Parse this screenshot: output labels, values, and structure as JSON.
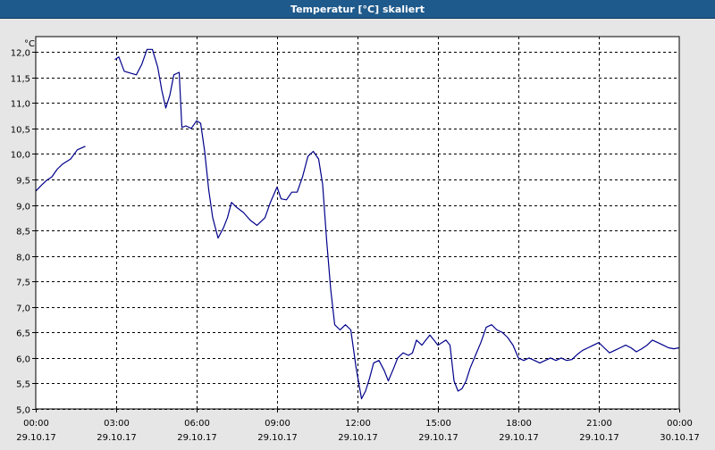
{
  "window": {
    "title": "Temperatur [°C] skaliert"
  },
  "chart_data": {
    "type": "line",
    "title": "Temperatur [°C] skaliert",
    "ylabel": "°C",
    "xlabel": "",
    "ylim": [
      5.0,
      12.3
    ],
    "xlim": [
      0,
      24
    ],
    "grid": true,
    "x_unit": "hours since 29.10.17 00:00",
    "y_ticks": [
      "5,0",
      "5,5",
      "6,0",
      "6,5",
      "7,0",
      "7,5",
      "8,0",
      "8,5",
      "9,0",
      "9,5",
      "10,0",
      "10,5",
      "11,0",
      "11,5",
      "12,0"
    ],
    "y_tick_values": [
      5.0,
      5.5,
      6.0,
      6.5,
      7.0,
      7.5,
      8.0,
      8.5,
      9.0,
      9.5,
      10.0,
      10.5,
      11.0,
      11.5,
      12.0
    ],
    "x_ticks": [
      {
        "time": "00:00",
        "date": "29.10.17",
        "hour": 0
      },
      {
        "time": "03:00",
        "date": "29.10.17",
        "hour": 3
      },
      {
        "time": "06:00",
        "date": "29.10.17",
        "hour": 6
      },
      {
        "time": "09:00",
        "date": "29.10.17",
        "hour": 9
      },
      {
        "time": "12:00",
        "date": "29.10.17",
        "hour": 12
      },
      {
        "time": "15:00",
        "date": "29.10.17",
        "hour": 15
      },
      {
        "time": "18:00",
        "date": "29.10.17",
        "hour": 18
      },
      {
        "time": "21:00",
        "date": "29.10.17",
        "hour": 21
      },
      {
        "time": "00:00",
        "date": "30.10.17",
        "hour": 24
      }
    ],
    "series": [
      {
        "color": "#00008b",
        "segments": [
          [
            [
              0.0,
              9.27
            ],
            [
              0.2,
              9.38
            ],
            [
              0.4,
              9.48
            ],
            [
              0.6,
              9.55
            ],
            [
              0.8,
              9.7
            ],
            [
              1.0,
              9.8
            ],
            [
              1.3,
              9.9
            ],
            [
              1.55,
              10.08
            ],
            [
              1.85,
              10.15
            ]
          ],
          [
            [
              2.95,
              11.85
            ],
            [
              3.1,
              11.9
            ],
            [
              3.3,
              11.62
            ],
            [
              3.55,
              11.58
            ],
            [
              3.75,
              11.55
            ],
            [
              3.95,
              11.75
            ],
            [
              4.15,
              12.05
            ],
            [
              4.35,
              12.05
            ],
            [
              4.55,
              11.7
            ],
            [
              4.7,
              11.25
            ],
            [
              4.85,
              10.9
            ],
            [
              5.0,
              11.15
            ],
            [
              5.15,
              11.55
            ],
            [
              5.35,
              11.6
            ],
            [
              5.45,
              10.52
            ],
            [
              5.6,
              10.55
            ],
            [
              5.8,
              10.5
            ],
            [
              6.0,
              10.65
            ],
            [
              6.15,
              10.6
            ],
            [
              6.3,
              10.05
            ],
            [
              6.45,
              9.3
            ],
            [
              6.6,
              8.75
            ],
            [
              6.8,
              8.35
            ],
            [
              7.0,
              8.55
            ],
            [
              7.15,
              8.75
            ],
            [
              7.3,
              9.05
            ],
            [
              7.5,
              8.95
            ],
            [
              7.75,
              8.85
            ],
            [
              8.0,
              8.7
            ],
            [
              8.25,
              8.6
            ],
            [
              8.55,
              8.75
            ],
            [
              8.75,
              9.05
            ],
            [
              9.0,
              9.35
            ],
            [
              9.15,
              9.12
            ],
            [
              9.35,
              9.1
            ],
            [
              9.55,
              9.25
            ],
            [
              9.75,
              9.25
            ],
            [
              9.95,
              9.55
            ],
            [
              10.15,
              9.95
            ],
            [
              10.35,
              10.05
            ],
            [
              10.55,
              9.9
            ],
            [
              10.7,
              9.4
            ],
            [
              10.85,
              8.3
            ],
            [
              11.0,
              7.35
            ],
            [
              11.15,
              6.65
            ],
            [
              11.35,
              6.55
            ],
            [
              11.55,
              6.65
            ],
            [
              11.75,
              6.55
            ],
            [
              11.95,
              5.8
            ],
            [
              12.15,
              5.2
            ],
            [
              12.3,
              5.35
            ],
            [
              12.45,
              5.6
            ],
            [
              12.6,
              5.9
            ],
            [
              12.8,
              5.95
            ],
            [
              13.0,
              5.75
            ],
            [
              13.15,
              5.55
            ],
            [
              13.35,
              5.8
            ],
            [
              13.5,
              6.0
            ],
            [
              13.7,
              6.1
            ],
            [
              13.9,
              6.05
            ],
            [
              14.05,
              6.1
            ],
            [
              14.2,
              6.35
            ],
            [
              14.4,
              6.25
            ],
            [
              14.55,
              6.35
            ],
            [
              14.7,
              6.45
            ],
            [
              14.85,
              6.35
            ],
            [
              15.0,
              6.25
            ],
            [
              15.15,
              6.3
            ],
            [
              15.3,
              6.35
            ],
            [
              15.45,
              6.25
            ],
            [
              15.6,
              5.55
            ],
            [
              15.75,
              5.35
            ],
            [
              15.9,
              5.4
            ],
            [
              16.05,
              5.55
            ],
            [
              16.2,
              5.8
            ],
            [
              16.4,
              6.05
            ],
            [
              16.6,
              6.3
            ],
            [
              16.8,
              6.6
            ],
            [
              17.0,
              6.65
            ],
            [
              17.2,
              6.55
            ],
            [
              17.4,
              6.5
            ],
            [
              17.6,
              6.4
            ],
            [
              17.8,
              6.25
            ],
            [
              18.0,
              6.0
            ],
            [
              18.2,
              5.95
            ],
            [
              18.4,
              6.0
            ],
            [
              18.6,
              5.95
            ],
            [
              18.8,
              5.9
            ],
            [
              19.0,
              5.95
            ],
            [
              19.2,
              6.0
            ],
            [
              19.4,
              5.95
            ],
            [
              19.6,
              6.0
            ],
            [
              19.8,
              5.95
            ],
            [
              20.0,
              5.97
            ],
            [
              20.2,
              6.07
            ],
            [
              20.4,
              6.15
            ],
            [
              20.6,
              6.2
            ],
            [
              20.8,
              6.25
            ],
            [
              21.0,
              6.3
            ],
            [
              21.2,
              6.2
            ],
            [
              21.4,
              6.1
            ],
            [
              21.6,
              6.15
            ],
            [
              21.8,
              6.2
            ],
            [
              22.0,
              6.25
            ],
            [
              22.2,
              6.2
            ],
            [
              22.4,
              6.12
            ],
            [
              22.6,
              6.18
            ],
            [
              22.8,
              6.25
            ],
            [
              23.0,
              6.35
            ],
            [
              23.2,
              6.3
            ],
            [
              23.4,
              6.25
            ],
            [
              23.6,
              6.2
            ],
            [
              23.8,
              6.18
            ],
            [
              24.0,
              6.2
            ]
          ]
        ]
      }
    ]
  }
}
